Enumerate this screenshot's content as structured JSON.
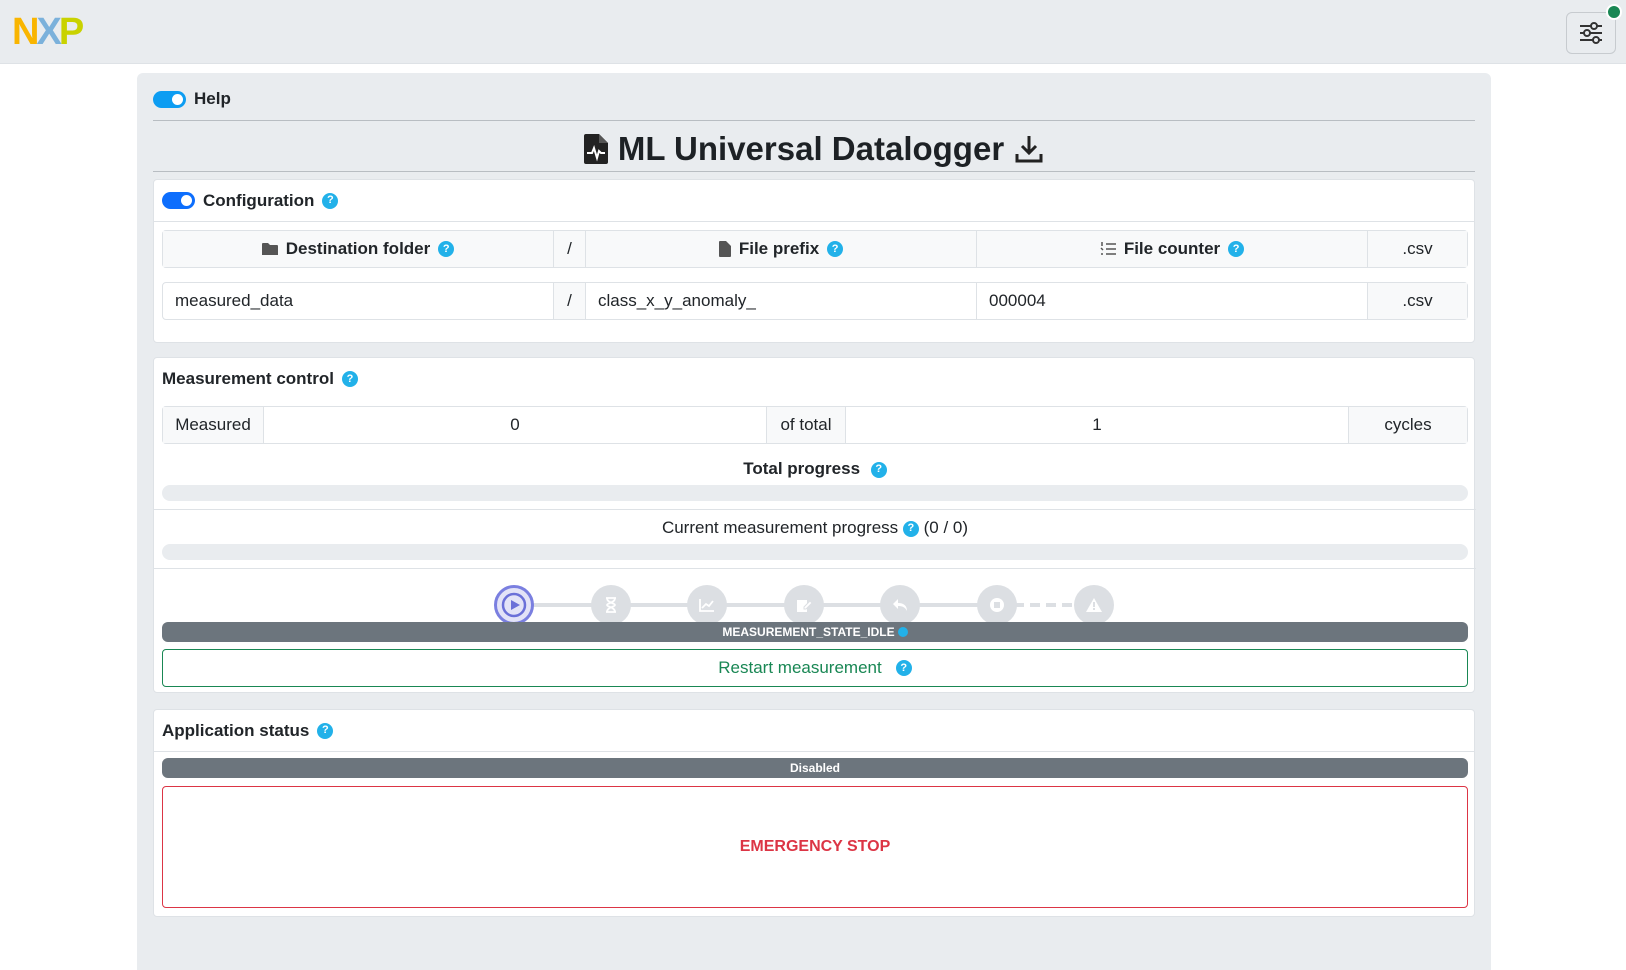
{
  "topbar": {
    "logo_text": [
      "N",
      "X",
      "P"
    ],
    "settings_icon": "sliders-icon"
  },
  "help": {
    "label": "Help",
    "toggle_on": true
  },
  "page": {
    "title": "ML Universal Datalogger"
  },
  "configuration": {
    "title": "Configuration",
    "headers": {
      "folder": "Destination folder",
      "separator": "/",
      "prefix": "File prefix",
      "counter": "File counter",
      "ext": ".csv"
    },
    "values": {
      "folder": "measured_data",
      "separator": "/",
      "prefix": "class_x_y_anomaly_",
      "counter": "000004",
      "ext": ".csv"
    }
  },
  "measurement": {
    "title": "Measurement control",
    "measured_label": "Measured",
    "measured_value": "0",
    "of_total_label": "of total",
    "total_value": "1",
    "cycles_label": "cycles",
    "total_progress_label": "Total progress",
    "total_progress": 0,
    "current_progress_label": "Current measurement progress",
    "current_progress_count": "(0 / 0)",
    "current_progress": 0,
    "steps": [
      "play-icon",
      "hourglass-icon",
      "chart-icon",
      "edit-icon",
      "undo-icon",
      "stop-icon",
      "warning-icon"
    ],
    "state": "MEASUREMENT_STATE_IDLE",
    "restart_label": "Restart measurement"
  },
  "application_status": {
    "title": "Application status",
    "status": "Disabled",
    "emergency_label": "EMERGENCY STOP"
  },
  "colors": {
    "accent": "#22b1e9",
    "success": "#198754",
    "danger": "#dc3545",
    "state_bar": "#6c757d"
  }
}
